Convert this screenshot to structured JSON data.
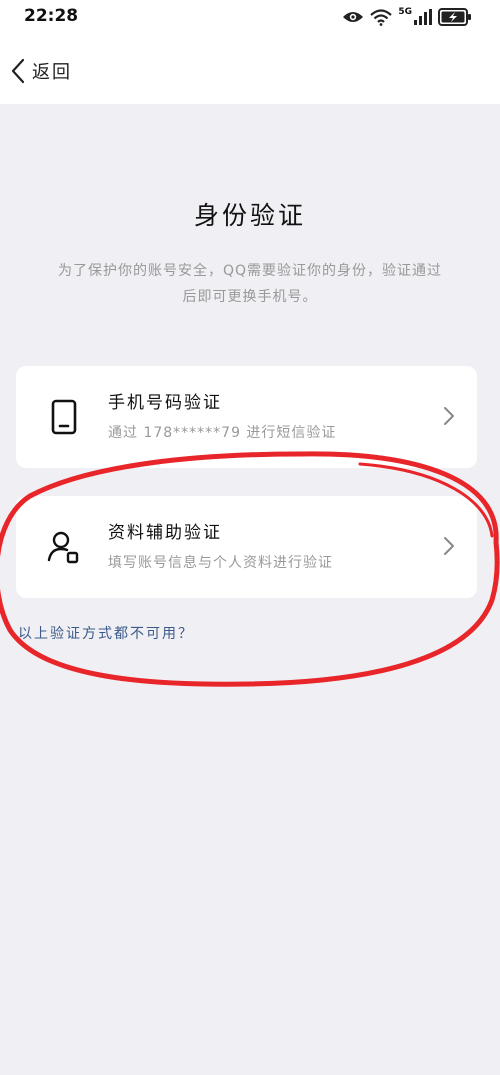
{
  "status_bar": {
    "time": "22:28",
    "network": "5G",
    "icons": [
      "eye-icon",
      "wifi-icon",
      "signal-icon",
      "battery-charging-icon"
    ]
  },
  "nav": {
    "back_label": "返回",
    "back_icon": "chevron-left-icon"
  },
  "page": {
    "title": "身份验证",
    "description_line1": "为了保护你的账号安全，QQ需要验证你的身份，验证通过",
    "description_line2": "后即可更换手机号。"
  },
  "options": [
    {
      "title": "手机号码验证",
      "subtitle": "通过 178******79 进行短信验证",
      "icon": "phone-icon"
    },
    {
      "title": "资料辅助验证",
      "subtitle": "填写账号信息与个人资料进行验证",
      "icon": "user-info-icon"
    }
  ],
  "alt_link": "以上验证方式都不可用？",
  "colors": {
    "background": "#efeff4",
    "card": "#ffffff",
    "link": "#3b5a8a",
    "annotation": "#e8262a"
  }
}
